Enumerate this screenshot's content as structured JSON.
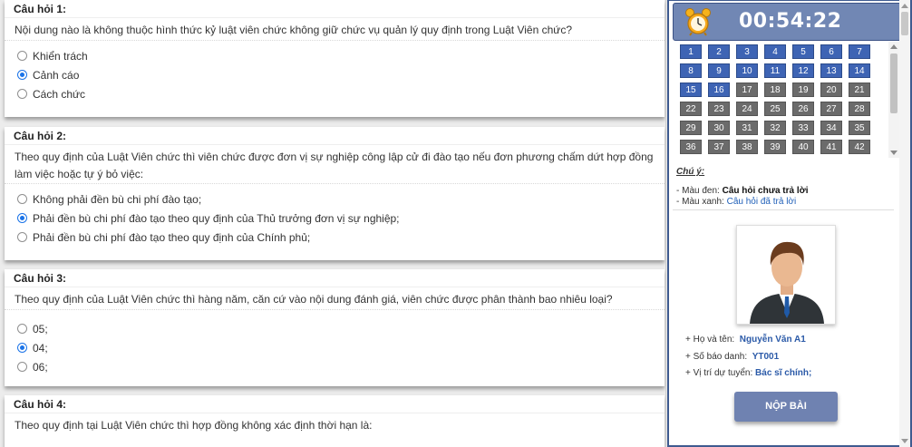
{
  "questions": [
    {
      "title": "Câu hỏi 1:",
      "text": "Nội dung nào là không thuộc hình thức kỷ luật viên chức không giữ chức vụ quản lý quy định trong Luật Viên chức?",
      "options": [
        {
          "label": "Khiển trách",
          "selected": false
        },
        {
          "label": "Cảnh cáo",
          "selected": true
        },
        {
          "label": "Cách chức",
          "selected": false
        }
      ]
    },
    {
      "title": "Câu hỏi 2:",
      "text": "Theo quy định của Luật Viên chức thì viên chức được đơn vị sự nghiệp công lập cử đi đào tạo nếu đơn phương chấm dứt hợp đồng làm việc hoặc tự ý bỏ việc:",
      "options": [
        {
          "label": "Không phải đền bù chi phí đào tạo;",
          "selected": false
        },
        {
          "label": "Phải đền bù chi phí đào tạo theo quy định của Thủ trưởng đơn vị sự nghiệp;",
          "selected": true
        },
        {
          "label": "Phải đền bù chi phí đào tạo theo quy định của Chính phủ;",
          "selected": false
        }
      ]
    },
    {
      "title": "Câu hỏi 3:",
      "text": "Theo quy định của Luật Viên chức thì hàng năm, căn cứ vào nội dung đánh giá, viên chức được phân thành bao nhiêu loại?",
      "options": [
        {
          "label": "05;",
          "selected": false
        },
        {
          "label": "04;",
          "selected": true
        },
        {
          "label": "06;",
          "selected": false
        }
      ]
    },
    {
      "title": "Câu hỏi 4:",
      "text": "Theo quy định tại Luật Viên chức thì hợp đồng không xác định thời hạn là:",
      "options": []
    }
  ],
  "timer": {
    "value": "00:54:22",
    "icon": "alarm-clock-icon"
  },
  "grid": {
    "answered": [
      "1",
      "2",
      "3",
      "4",
      "5",
      "6",
      "7",
      "8",
      "9",
      "10",
      "11",
      "12",
      "13",
      "14",
      "15",
      "16"
    ],
    "unanswered": [
      "17",
      "18",
      "19",
      "20",
      "21",
      "22",
      "23",
      "24",
      "25",
      "26",
      "27",
      "28",
      "29",
      "30",
      "31",
      "32",
      "33",
      "34",
      "35",
      "36",
      "37",
      "38",
      "39",
      "40",
      "41",
      "42"
    ],
    "answered_color": "#3e64b4",
    "unanswered_color": "#6b6b6b"
  },
  "legend": {
    "title": "Chú ý:",
    "line1_prefix": "- Màu đen: ",
    "line1_value": "Câu hỏi chưa trả lời",
    "line2_prefix": "- Màu xanh: ",
    "line2_value": "Câu hỏi đã trả lời"
  },
  "profile": {
    "name_label": "Họ và tên:",
    "name": "Nguyễn Văn A1",
    "id_label": "Số báo danh:",
    "id": "YT001",
    "position_label": "Vị trí dự tuyển:",
    "position": "Bác sĩ chính;"
  },
  "submit_label": "NỘP BÀI"
}
